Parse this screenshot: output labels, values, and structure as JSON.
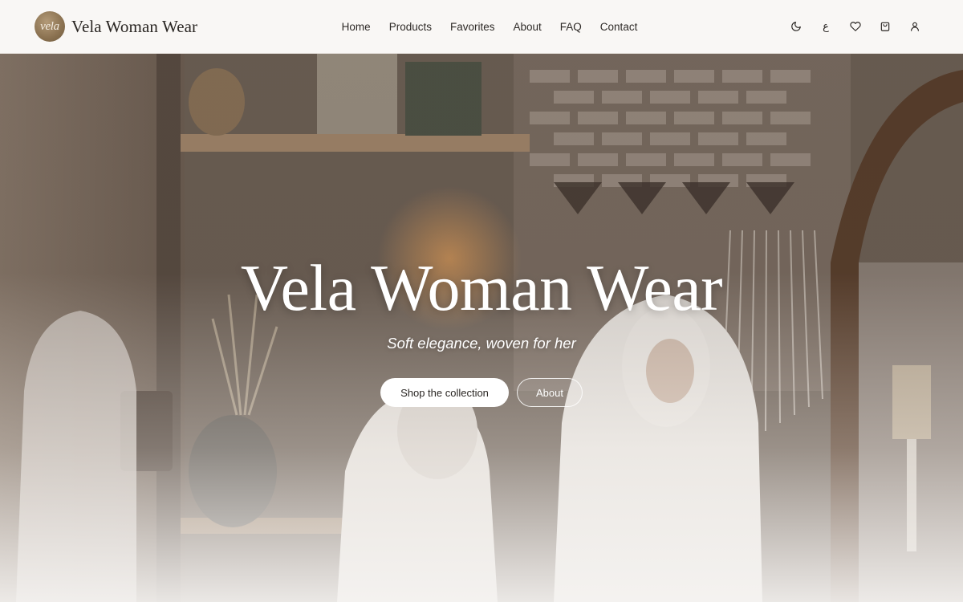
{
  "header": {
    "logo_text": "vela",
    "brand": "Vela Woman Wear",
    "nav": [
      {
        "label": "Home",
        "name": "nav-home"
      },
      {
        "label": "Products",
        "name": "nav-products"
      },
      {
        "label": "Favorites",
        "name": "nav-favorites"
      },
      {
        "label": "About",
        "name": "nav-about"
      },
      {
        "label": "FAQ",
        "name": "nav-faq"
      },
      {
        "label": "Contact",
        "name": "nav-contact"
      }
    ],
    "icons": [
      "moon-icon",
      "language-toggle",
      "heart-icon",
      "bag-icon",
      "user-icon"
    ],
    "language_label": "ع"
  },
  "hero": {
    "title": "Vela Woman Wear",
    "subtitle": "Soft elegance, woven for her",
    "primary_cta": "Shop the collection",
    "secondary_cta": "About"
  },
  "colors": {
    "header_bg": "#f9f7f5",
    "text": "#2a2623",
    "logo_gold": "#8a7150",
    "hero_text": "#ffffff"
  }
}
